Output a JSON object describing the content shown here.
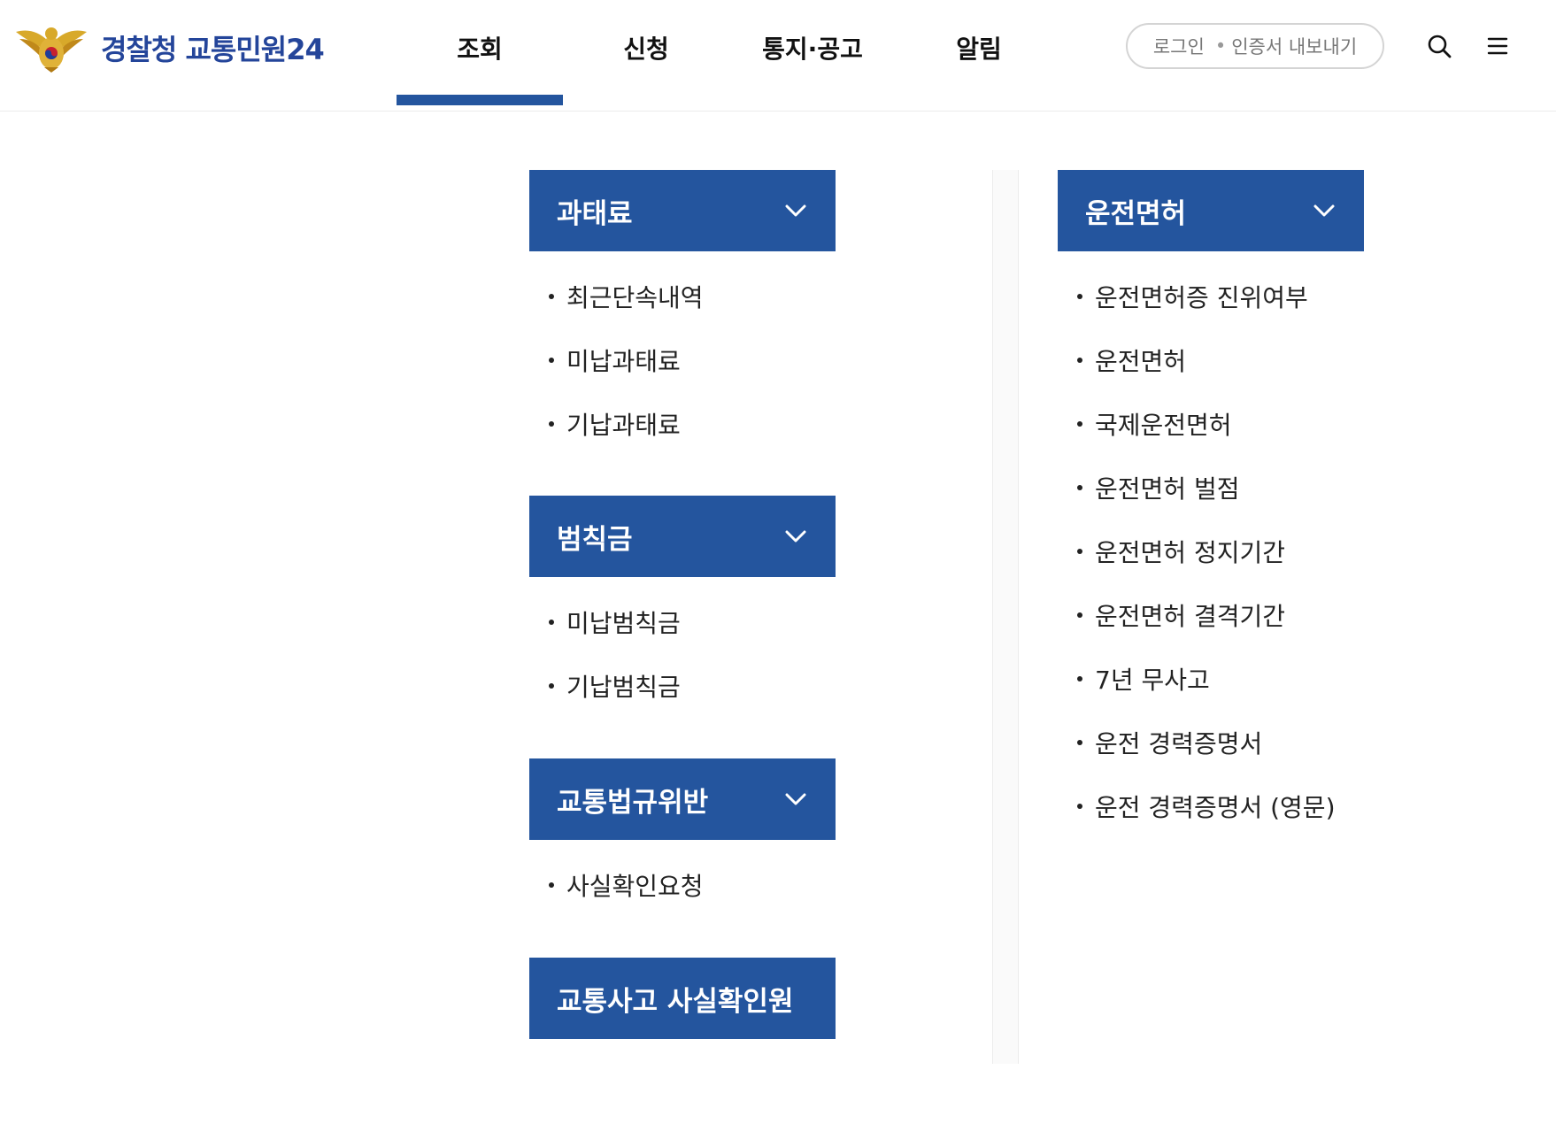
{
  "brand": {
    "logo_text": "경찰청 교통민원24"
  },
  "nav": {
    "items": [
      {
        "label": "조회",
        "active": true
      },
      {
        "label": "신청",
        "active": false
      },
      {
        "label": "통지·공고",
        "active": false
      },
      {
        "label": "알림",
        "active": false
      }
    ]
  },
  "header": {
    "login_label": "로그인",
    "cert_separator": "•",
    "cert_label": "인증서 내보내기"
  },
  "icons": {
    "search": "search-icon",
    "menu": "hamburger-menu-icon",
    "chevron": "chevron-down-icon"
  },
  "colors": {
    "primary": "#24559e",
    "logo_text": "#24459a"
  },
  "left_column": {
    "groups": [
      {
        "title": "과태료",
        "expandable": true,
        "items": [
          "최근단속내역",
          "미납과태료",
          "기납과태료"
        ]
      },
      {
        "title": "범칙금",
        "expandable": true,
        "items": [
          "미납범칙금",
          "기납범칙금"
        ]
      },
      {
        "title": "교통법규위반",
        "expandable": true,
        "items": [
          "사실확인요청"
        ]
      },
      {
        "title": "교통사고 사실확인원",
        "expandable": false,
        "items": []
      }
    ]
  },
  "right_column": {
    "groups": [
      {
        "title": "운전면허",
        "expandable": true,
        "items": [
          "운전면허증 진위여부",
          "운전면허",
          "국제운전면허",
          "운전면허 벌점",
          "운전면허 정지기간",
          "운전면허 결격기간",
          "7년 무사고",
          "운전 경력증명서",
          "운전 경력증명서 (영문)"
        ]
      }
    ]
  }
}
